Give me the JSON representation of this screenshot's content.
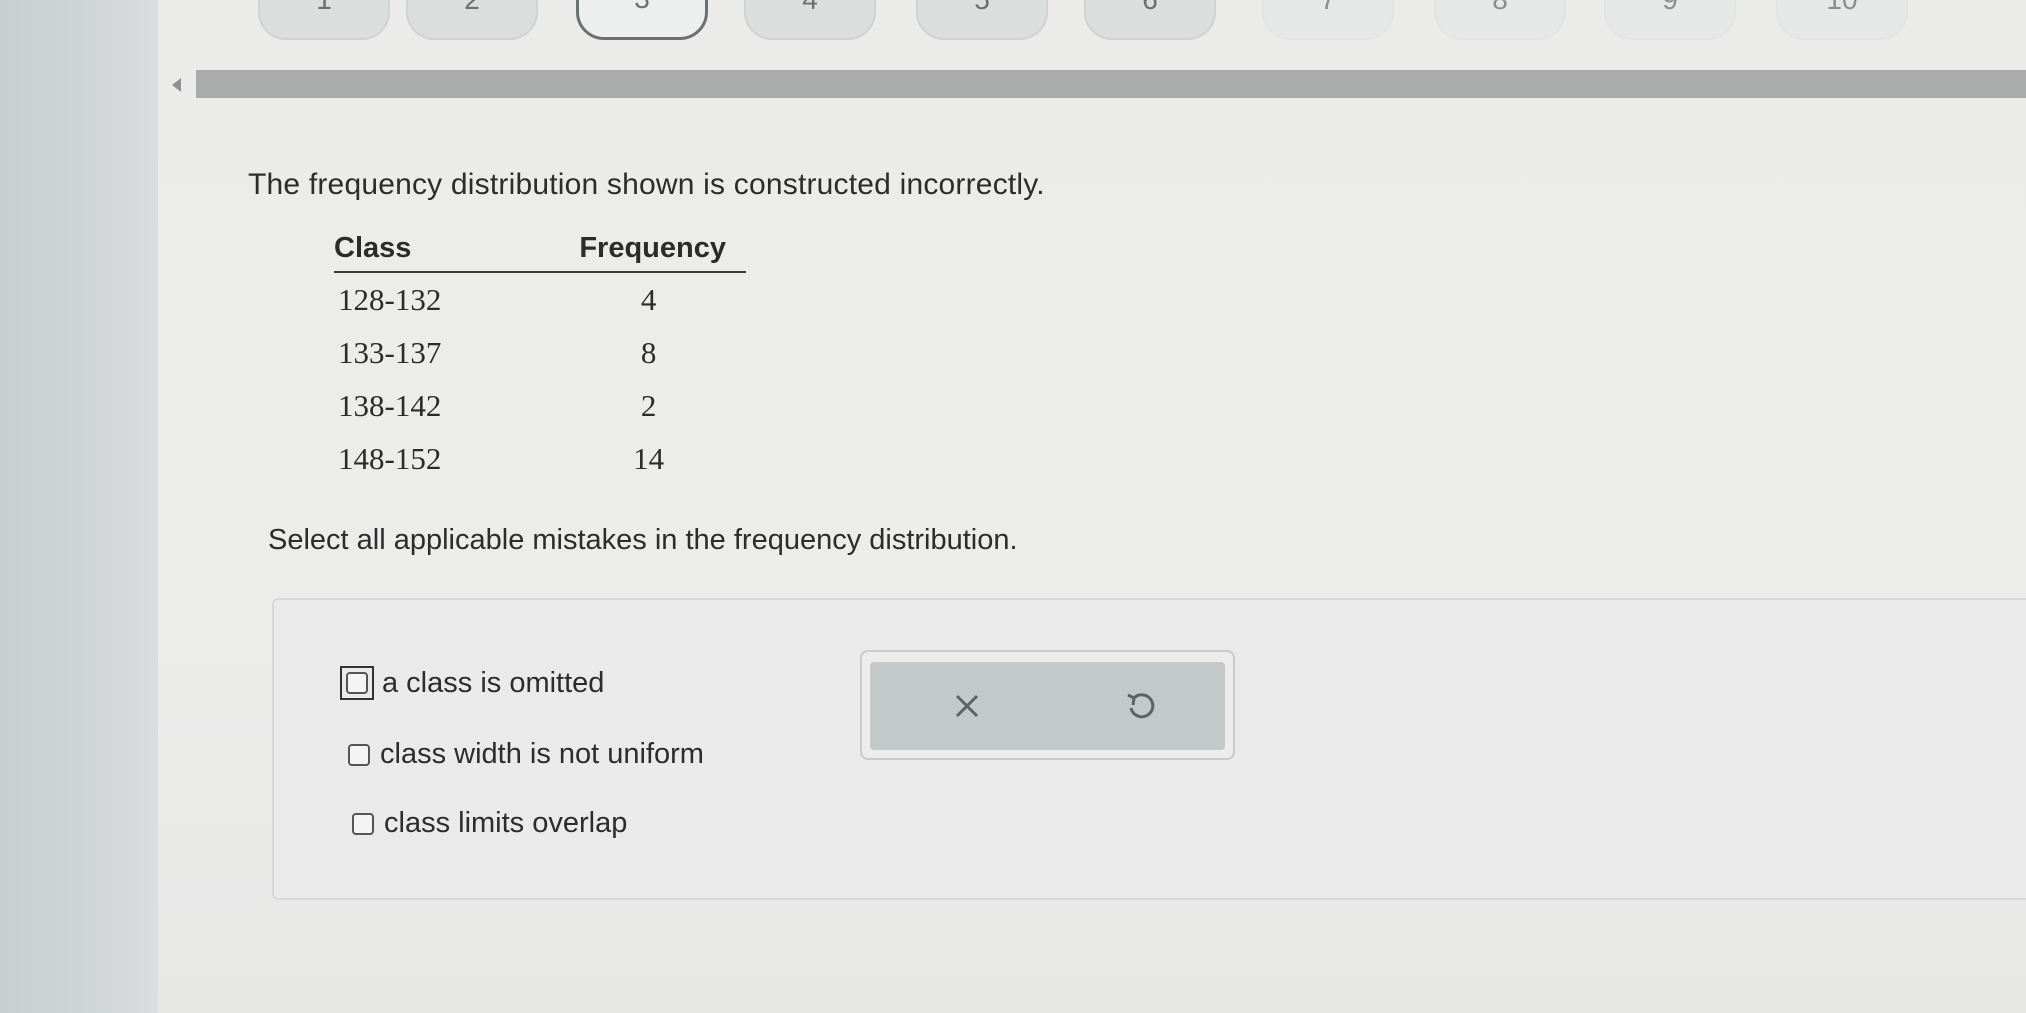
{
  "pager": {
    "items": [
      {
        "label": "1",
        "state": "normal"
      },
      {
        "label": "2",
        "state": "normal"
      },
      {
        "label": "3",
        "state": "active"
      },
      {
        "label": "4",
        "state": "normal"
      },
      {
        "label": "5",
        "state": "normal"
      },
      {
        "label": "6",
        "state": "normal"
      },
      {
        "label": "7",
        "state": "faded"
      },
      {
        "label": "8",
        "state": "faded"
      },
      {
        "label": "9",
        "state": "faded"
      },
      {
        "label": "10",
        "state": "faded"
      }
    ]
  },
  "question": {
    "statement": "The frequency distribution shown is constructed incorrectly.",
    "table": {
      "headers": [
        "Class",
        "Frequency"
      ],
      "rows": [
        {
          "class": "128-132",
          "frequency": "4"
        },
        {
          "class": "133-137",
          "frequency": "8"
        },
        {
          "class": "138-142",
          "frequency": "2"
        },
        {
          "class": "148-152",
          "frequency": "14"
        }
      ]
    },
    "prompt": "Select all applicable mistakes in the frequency distribution."
  },
  "answers": {
    "options": [
      {
        "label": "a class is omitted",
        "checked": false,
        "focused": true
      },
      {
        "label": "class width is not uniform",
        "checked": false,
        "focused": false
      },
      {
        "label": "class limits overlap",
        "checked": false,
        "focused": false
      }
    ]
  },
  "actions": {
    "clear_icon": "close-icon",
    "undo_icon": "undo-icon"
  },
  "colors": {
    "split_bar": "#a9acab",
    "action_bg": "#c3c8c8",
    "icon": "#5a6466"
  }
}
